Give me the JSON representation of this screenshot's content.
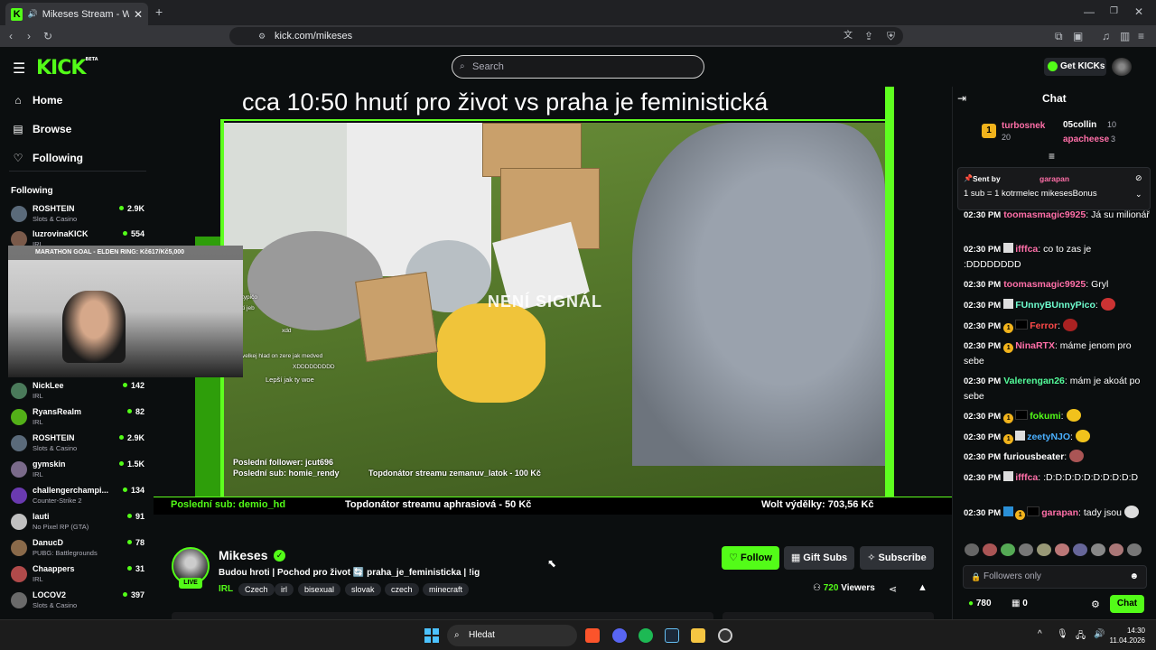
{
  "browser": {
    "tab_title": "Mikeses Stream - Watch Live",
    "url": "kick.com/mikeses"
  },
  "header": {
    "logo": "KICK",
    "logo_beta": "BETA",
    "search_placeholder": "Search",
    "get_kicks": "Get KICKs"
  },
  "sidebar": {
    "nav": [
      "Home",
      "Browse",
      "Following"
    ],
    "following_heading": "Following",
    "channels": [
      {
        "name": "ROSHTEIN",
        "category": "Slots & Casino",
        "viewers": "2.9K",
        "color": "#5a6a7a"
      },
      {
        "name": "luzrovinaKICK",
        "category": "IRL",
        "viewers": "554",
        "color": "#7a5a4a"
      },
      {
        "name": "NickLee",
        "category": "IRL",
        "viewers": "142",
        "color": "#4a7a5a"
      },
      {
        "name": "RyansRealm",
        "category": "IRL",
        "viewers": "82",
        "color": "#53b018"
      },
      {
        "name": "ROSHTEIN",
        "category": "Slots & Casino",
        "viewers": "2.9K",
        "color": "#5a6a7a"
      },
      {
        "name": "gymskin",
        "category": "IRL",
        "viewers": "1.5K",
        "color": "#7a6a8a"
      },
      {
        "name": "challengerchampi...",
        "category": "Counter-Strike 2",
        "viewers": "134",
        "color": "#6a3ab0"
      },
      {
        "name": "lauti",
        "category": "No Pixel RP (GTA)",
        "viewers": "91",
        "color": "#c0c0c0"
      },
      {
        "name": "DanucD",
        "category": "PUBG: Battlegrounds",
        "viewers": "78",
        "color": "#8a6a4a"
      },
      {
        "name": "Chaappers",
        "category": "IRL",
        "viewers": "31",
        "color": "#b04a4a"
      },
      {
        "name": "LOCOV2",
        "category": "Slots & Casino",
        "viewers": "397",
        "color": "#6a6a6a"
      }
    ]
  },
  "webcam": {
    "goal": "MARATHON GOAL - ELDEN RING: Kč617/Kč5,000"
  },
  "video": {
    "title": "cca 10:50 hnutí pro život vs praha je feministická",
    "no_signal": "NENÍ SIGNÁL",
    "overlay_chat": [
      "typičo",
      "ti jeb",
      "xdd",
      "velkej hlad on zere jak medved",
      "XDDDDDDDDD",
      "Lepší jak ty woe"
    ],
    "last_follower": "Poslední follower: jcut696",
    "last_sub_inner": "Poslední sub: homie_rendy",
    "top_donator_inner": "Topdonátor streamu zemanuv_latok - 100 Kč",
    "ticker_last_sub": "Poslední sub: demio_hd",
    "ticker_top": "Topdonátor streamu aphrasiová - 50 Kč",
    "ticker_wolt": "Wolt výdělky: 703,56 Kč"
  },
  "streamer": {
    "name": "Mikeses",
    "live": "LIVE",
    "title": "Budou hroti | Pochod pro život 🔄 praha_je_feministicka | !ig",
    "category": "IRL",
    "tags": [
      "Czech",
      "irl",
      "bisexual",
      "slovak",
      "czech",
      "minecraft"
    ],
    "follow": "Follow",
    "gift_subs": "Gift Subs",
    "subscribe": "Subscribe",
    "viewers_count": "720",
    "viewers_label": "Viewers"
  },
  "chat": {
    "title": "Chat",
    "top_gifters": [
      {
        "rank": "1",
        "name": "turbosnek",
        "count": "20"
      },
      {
        "name": "05collin",
        "count": "10"
      },
      {
        "name": "apacheese",
        "count": "3"
      }
    ],
    "pinned_sender_label": "Sent by",
    "pinned_sender": "garapan",
    "pinned_text": "1 sub = 1 kotrmelec mikesesBonus",
    "messages": [
      {
        "time": "02:30 PM",
        "user": "toomasmagic9925",
        "color": "#ff6fa8",
        "text": ": Já su milionář"
      },
      {
        "time": "02:30 PM",
        "user": "ifffca",
        "color": "#ff6fa8",
        "text": ": co to zas je :DDDDDDDD"
      },
      {
        "time": "02:30 PM",
        "user": "toomasmagic9925",
        "color": "#ff6fa8",
        "text": ": Gryl"
      },
      {
        "time": "02:30 PM",
        "user": "FUnnyBUnnyPico",
        "color": "#6fffd0",
        "text": ":"
      },
      {
        "time": "02:30 PM",
        "user": "Ferror",
        "color": "#ff4a4a",
        "text": ":"
      },
      {
        "time": "02:30 PM",
        "user": "NinaRTX",
        "color": "#ff6fa8",
        "text": ": máme jenom pro sebe"
      },
      {
        "time": "02:30 PM",
        "user": "Valerengan26",
        "color": "#53fc9a",
        "text": ": mám je akoát po sebe"
      },
      {
        "time": "02:30 PM",
        "user": "fokumi",
        "color": "#53fc18",
        "text": ":"
      },
      {
        "time": "02:30 PM",
        "user": "zeetyNJO",
        "color": "#4ab0ff",
        "text": ":"
      },
      {
        "time": "02:30 PM",
        "user": "furiousbeater",
        "color": "#fff",
        "text": ":"
      },
      {
        "time": "02:30 PM",
        "user": "ifffca",
        "color": "#ff6fa8",
        "text": ": :D:D:D:D:D:D:D:D:D:D"
      },
      {
        "time": "02:30 PM",
        "user": "garapan",
        "color": "#ff6fa8",
        "text": ": tady jsou"
      }
    ],
    "input_placeholder": "Followers only",
    "points": "780",
    "gifts": "0",
    "send": "Chat"
  },
  "taskbar": {
    "search": "Hledat",
    "time": "14:30",
    "date": "11.04.2026"
  }
}
